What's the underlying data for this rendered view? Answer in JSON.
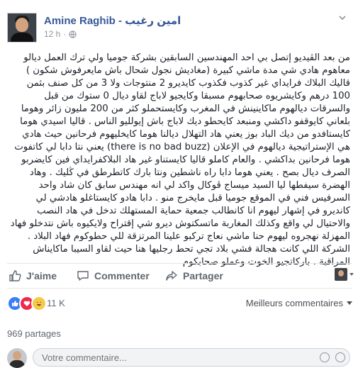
{
  "post": {
    "author": "Amine Raghib - امين رغيب",
    "time": "12 h",
    "text": "من بعد الڤيديو إتصل بي احد المهندسين السابقين بشركة جوميا ولي ترك العمل ديالو معاهوم هادي شي مدة ماشي كبيرة (مغاديش نجول شحال باش مايعرفوش شكون ) قاليك البلاك فرايداي غير كذوب فكذوب كايديرو 2 منتوجات ولا 3 من كل صنف بثمن 100 درهم وكايشريوه صحابهوم مسبقا وكايجيو لاباج لقاو ديال 0 ستوك من قبل والسرقات ديالهوم ماكاينينش في المغرب وكايستحملو كثر من 200 مليون زائر وهوما بلعاني كايوقفو داكشي ومنبعد كايحطو ديك لاباج باش إيولليو الناس . قاليا اسيدي هوما كايستافدو من ديك الباد بوز يعني هاد التهلال ديالنا هوما كايخليهوم فرحانين حيث هادي هي الإستراتيجية ديالهوم في الإعلان (there is no bad buzz) يعني نتا دابا لي كاتفوت هوما فرحانين بداكشي . والعام كاملو قاليا كايستناو غير هاد البلاكفرايداي فين كايضربو الصرف ديال بصح . يعني هوما دابا راه ناشطين ونتا بارك كاتطرطق في ڭليك . وهاد الهضرة سيفطها ليا السيد ميساج ڤوكال واكد لي انه مهندس سابق كان شاد واحد السرفيس فني في الموقع جوميا قبل مايخرج منو . دابا هادو كايستاغلو هادشي لي كانديرو في إشهار ليهوم انا كانطالب جمعية حماية المستهلك تدخل في هاد النصب والاحتيال لي واقع وكذلك المغاربة ماتسكتوش ديرو شي إقتراح ولايكيوه باش نتدخلو فهاد المهزلة نهجروه ليهوم حنا ماشي نعاج تركبو علينا المرتزقة للي حطوكوم فهاد البلاد . الشركة اللي كانت هجالة فشي بلاد تجي تحط رجليها هنا حيت لقاو السيبا ماكايناش المراقبة . باركاتجيو الخوت وعملو صحابكوم"
  },
  "actions": {
    "like": "J'aime",
    "comment": "Commenter",
    "share": "Partager"
  },
  "reactions": {
    "count": "11 K",
    "sort_label": "Meilleurs commentaires"
  },
  "shares": "969 partages",
  "composer": {
    "placeholder": "Votre commentaire..."
  },
  "colors": {
    "link": "#365899",
    "like": "#3a7df6",
    "love": "#f0284a",
    "haha": "#f7c94b"
  }
}
